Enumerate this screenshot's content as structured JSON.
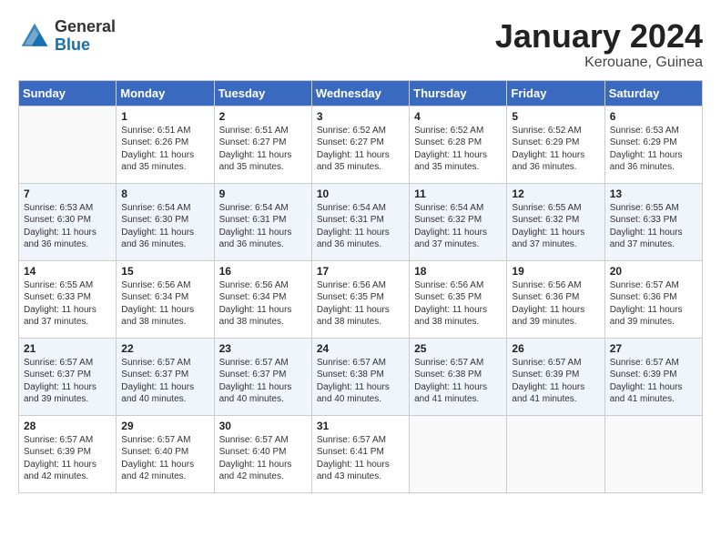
{
  "logo": {
    "general": "General",
    "blue": "Blue"
  },
  "title": "January 2024",
  "location": "Kerouane, Guinea",
  "weekdays": [
    "Sunday",
    "Monday",
    "Tuesday",
    "Wednesday",
    "Thursday",
    "Friday",
    "Saturday"
  ],
  "weeks": [
    [
      {
        "day": "",
        "info": ""
      },
      {
        "day": "1",
        "info": "Sunrise: 6:51 AM\nSunset: 6:26 PM\nDaylight: 11 hours\nand 35 minutes."
      },
      {
        "day": "2",
        "info": "Sunrise: 6:51 AM\nSunset: 6:27 PM\nDaylight: 11 hours\nand 35 minutes."
      },
      {
        "day": "3",
        "info": "Sunrise: 6:52 AM\nSunset: 6:27 PM\nDaylight: 11 hours\nand 35 minutes."
      },
      {
        "day": "4",
        "info": "Sunrise: 6:52 AM\nSunset: 6:28 PM\nDaylight: 11 hours\nand 35 minutes."
      },
      {
        "day": "5",
        "info": "Sunrise: 6:52 AM\nSunset: 6:29 PM\nDaylight: 11 hours\nand 36 minutes."
      },
      {
        "day": "6",
        "info": "Sunrise: 6:53 AM\nSunset: 6:29 PM\nDaylight: 11 hours\nand 36 minutes."
      }
    ],
    [
      {
        "day": "7",
        "info": "Sunrise: 6:53 AM\nSunset: 6:30 PM\nDaylight: 11 hours\nand 36 minutes."
      },
      {
        "day": "8",
        "info": "Sunrise: 6:54 AM\nSunset: 6:30 PM\nDaylight: 11 hours\nand 36 minutes."
      },
      {
        "day": "9",
        "info": "Sunrise: 6:54 AM\nSunset: 6:31 PM\nDaylight: 11 hours\nand 36 minutes."
      },
      {
        "day": "10",
        "info": "Sunrise: 6:54 AM\nSunset: 6:31 PM\nDaylight: 11 hours\nand 36 minutes."
      },
      {
        "day": "11",
        "info": "Sunrise: 6:54 AM\nSunset: 6:32 PM\nDaylight: 11 hours\nand 37 minutes."
      },
      {
        "day": "12",
        "info": "Sunrise: 6:55 AM\nSunset: 6:32 PM\nDaylight: 11 hours\nand 37 minutes."
      },
      {
        "day": "13",
        "info": "Sunrise: 6:55 AM\nSunset: 6:33 PM\nDaylight: 11 hours\nand 37 minutes."
      }
    ],
    [
      {
        "day": "14",
        "info": "Sunrise: 6:55 AM\nSunset: 6:33 PM\nDaylight: 11 hours\nand 37 minutes."
      },
      {
        "day": "15",
        "info": "Sunrise: 6:56 AM\nSunset: 6:34 PM\nDaylight: 11 hours\nand 38 minutes."
      },
      {
        "day": "16",
        "info": "Sunrise: 6:56 AM\nSunset: 6:34 PM\nDaylight: 11 hours\nand 38 minutes."
      },
      {
        "day": "17",
        "info": "Sunrise: 6:56 AM\nSunset: 6:35 PM\nDaylight: 11 hours\nand 38 minutes."
      },
      {
        "day": "18",
        "info": "Sunrise: 6:56 AM\nSunset: 6:35 PM\nDaylight: 11 hours\nand 38 minutes."
      },
      {
        "day": "19",
        "info": "Sunrise: 6:56 AM\nSunset: 6:36 PM\nDaylight: 11 hours\nand 39 minutes."
      },
      {
        "day": "20",
        "info": "Sunrise: 6:57 AM\nSunset: 6:36 PM\nDaylight: 11 hours\nand 39 minutes."
      }
    ],
    [
      {
        "day": "21",
        "info": "Sunrise: 6:57 AM\nSunset: 6:37 PM\nDaylight: 11 hours\nand 39 minutes."
      },
      {
        "day": "22",
        "info": "Sunrise: 6:57 AM\nSunset: 6:37 PM\nDaylight: 11 hours\nand 40 minutes."
      },
      {
        "day": "23",
        "info": "Sunrise: 6:57 AM\nSunset: 6:37 PM\nDaylight: 11 hours\nand 40 minutes."
      },
      {
        "day": "24",
        "info": "Sunrise: 6:57 AM\nSunset: 6:38 PM\nDaylight: 11 hours\nand 40 minutes."
      },
      {
        "day": "25",
        "info": "Sunrise: 6:57 AM\nSunset: 6:38 PM\nDaylight: 11 hours\nand 41 minutes."
      },
      {
        "day": "26",
        "info": "Sunrise: 6:57 AM\nSunset: 6:39 PM\nDaylight: 11 hours\nand 41 minutes."
      },
      {
        "day": "27",
        "info": "Sunrise: 6:57 AM\nSunset: 6:39 PM\nDaylight: 11 hours\nand 41 minutes."
      }
    ],
    [
      {
        "day": "28",
        "info": "Sunrise: 6:57 AM\nSunset: 6:39 PM\nDaylight: 11 hours\nand 42 minutes."
      },
      {
        "day": "29",
        "info": "Sunrise: 6:57 AM\nSunset: 6:40 PM\nDaylight: 11 hours\nand 42 minutes."
      },
      {
        "day": "30",
        "info": "Sunrise: 6:57 AM\nSunset: 6:40 PM\nDaylight: 11 hours\nand 42 minutes."
      },
      {
        "day": "31",
        "info": "Sunrise: 6:57 AM\nSunset: 6:41 PM\nDaylight: 11 hours\nand 43 minutes."
      },
      {
        "day": "",
        "info": ""
      },
      {
        "day": "",
        "info": ""
      },
      {
        "day": "",
        "info": ""
      }
    ]
  ]
}
